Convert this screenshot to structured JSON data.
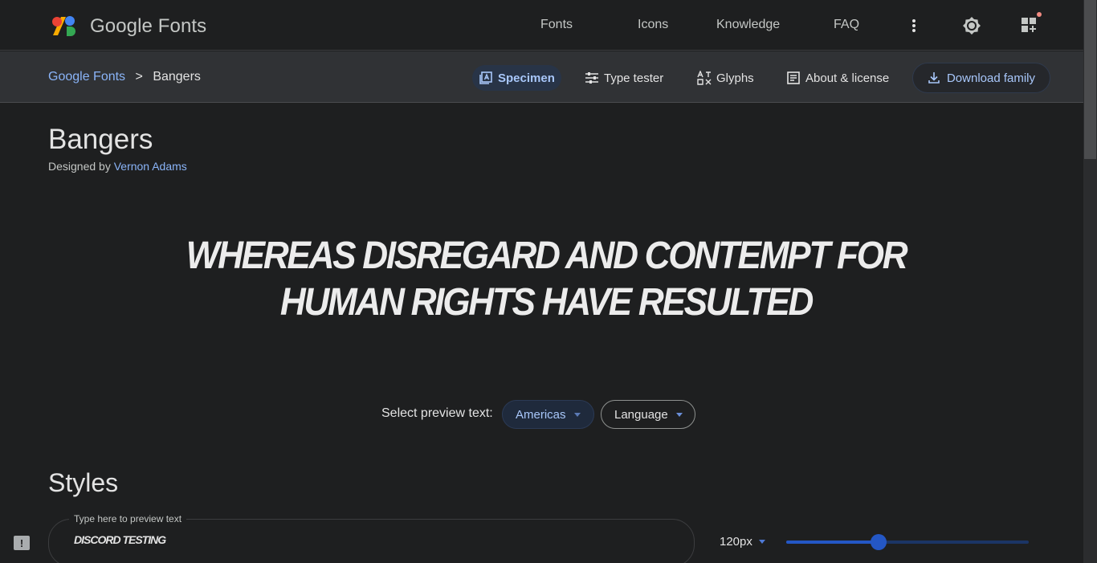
{
  "header": {
    "brand": "Google Fonts",
    "nav": [
      "Fonts",
      "Icons",
      "Knowledge",
      "FAQ"
    ],
    "icons": [
      "more-vert-icon",
      "theme-toggle-icon",
      "apps-grid-icon"
    ],
    "notification_dot_color": "#f28b82"
  },
  "subnav": {
    "breadcrumb": {
      "root": "Google Fonts",
      "separator": ">",
      "current": "Bangers"
    },
    "tabs": [
      "Specimen",
      "Type tester",
      "Glyphs",
      "About & license"
    ],
    "active_tab": "Specimen",
    "download_label": "Download family"
  },
  "family": {
    "name": "Bangers",
    "designed_by_prefix": "Designed by",
    "designer": "Vernon Adams"
  },
  "hero_text": "Whereas disregard and contempt for human rights have resulted",
  "preview_select": {
    "label": "Select preview text:",
    "region": "Americas",
    "language": "Language"
  },
  "styles": {
    "heading": "Styles",
    "preview_label": "Type here to preview text",
    "preview_value": "Discord Testing",
    "size": "120px",
    "size_slider_fraction": 0.38
  },
  "colors": {
    "background": "#1e1f20",
    "accent": "#8ab4f8",
    "active_tab_bg": "#283447",
    "slider": "#2457c5"
  }
}
